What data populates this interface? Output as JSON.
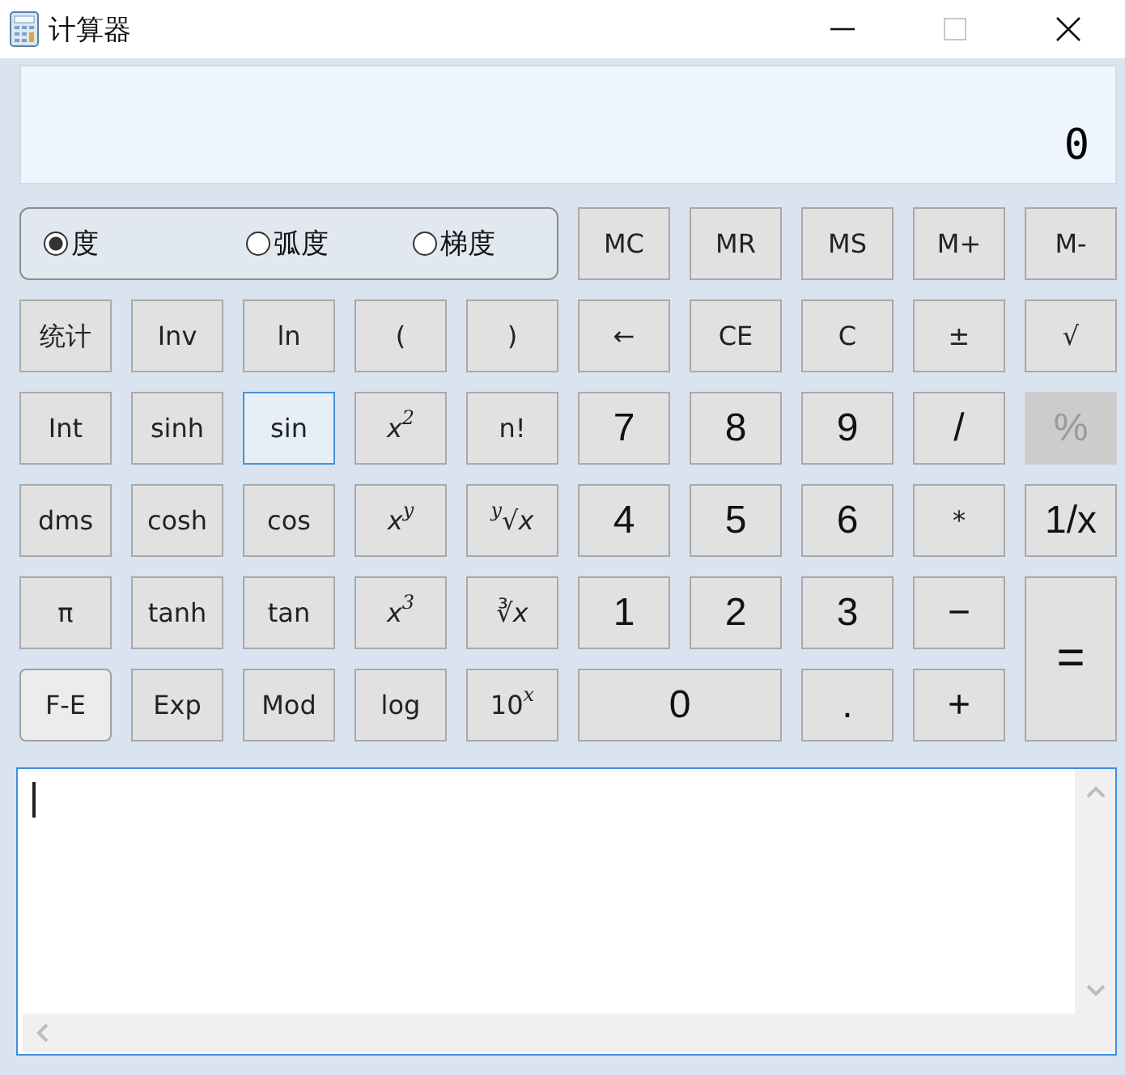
{
  "window": {
    "title": "计算器"
  },
  "display": {
    "value": "0"
  },
  "angle_units": [
    {
      "label": "度",
      "selected": true
    },
    {
      "label": "弧度",
      "selected": false
    },
    {
      "label": "梯度",
      "selected": false
    }
  ],
  "memory_keys": [
    {
      "label": "MC"
    },
    {
      "label": "MR"
    },
    {
      "label": "MS"
    },
    {
      "label": "M+"
    },
    {
      "label": "M-"
    }
  ],
  "keys": [
    {
      "label": "统计",
      "kind": "key",
      "focused": false,
      "disabled": false
    },
    {
      "label": "Inv",
      "kind": "key",
      "focused": false,
      "disabled": false
    },
    {
      "label": "ln",
      "kind": "key",
      "focused": false,
      "disabled": false
    },
    {
      "label": "(",
      "kind": "key",
      "focused": false,
      "disabled": false
    },
    {
      "label": ")",
      "kind": "key",
      "focused": false,
      "disabled": false
    },
    {
      "label": "←",
      "kind": "key",
      "focused": false,
      "disabled": false
    },
    {
      "label": "CE",
      "kind": "key",
      "focused": false,
      "disabled": false
    },
    {
      "label": "C",
      "kind": "key",
      "focused": false,
      "disabled": false
    },
    {
      "label": "±",
      "kind": "key",
      "focused": false,
      "disabled": false
    },
    {
      "label": "√",
      "kind": "key",
      "focused": false,
      "disabled": false
    },
    {
      "label": "Int",
      "kind": "key",
      "focused": false,
      "disabled": false
    },
    {
      "label": "sinh",
      "kind": "key",
      "focused": false,
      "disabled": false
    },
    {
      "label": "sin",
      "kind": "key",
      "focused": true,
      "disabled": false
    },
    {
      "label": "*x*$^{2}$",
      "kind": "key",
      "focused": false,
      "disabled": false
    },
    {
      "label": "n!",
      "kind": "key",
      "focused": false,
      "disabled": false
    },
    {
      "label": "7",
      "kind": "digit",
      "focused": false,
      "disabled": false
    },
    {
      "label": "8",
      "kind": "digit",
      "focused": false,
      "disabled": false
    },
    {
      "label": "9",
      "kind": "digit",
      "focused": false,
      "disabled": false
    },
    {
      "label": "/",
      "kind": "digit",
      "focused": false,
      "disabled": false
    },
    {
      "label": "%",
      "kind": "digit",
      "focused": false,
      "disabled": true
    },
    {
      "label": "dms",
      "kind": "key",
      "focused": false,
      "disabled": false
    },
    {
      "label": "cosh",
      "kind": "key",
      "focused": false,
      "disabled": false
    },
    {
      "label": "cos",
      "kind": "key",
      "focused": false,
      "disabled": false
    },
    {
      "label": "*x*$^{y}$",
      "kind": "key",
      "focused": false,
      "disabled": false
    },
    {
      "label": "$^{y}$√*x*",
      "kind": "key",
      "focused": false,
      "disabled": false
    },
    {
      "label": "4",
      "kind": "digit",
      "focused": false,
      "disabled": false
    },
    {
      "label": "5",
      "kind": "digit",
      "focused": false,
      "disabled": false
    },
    {
      "label": "6",
      "kind": "digit",
      "focused": false,
      "disabled": false
    },
    {
      "label": "*",
      "kind": "key",
      "focused": false,
      "disabled": false
    },
    {
      "label": "1/x",
      "kind": "digit",
      "focused": false,
      "disabled": false
    },
    {
      "label": "π",
      "kind": "key",
      "focused": false,
      "disabled": false
    },
    {
      "label": "tanh",
      "kind": "key",
      "focused": false,
      "disabled": false
    },
    {
      "label": "tan",
      "kind": "key",
      "focused": false,
      "disabled": false
    },
    {
      "label": "*x*$^{3}$",
      "kind": "key",
      "focused": false,
      "disabled": false
    },
    {
      "label": "∛*x*",
      "kind": "key",
      "focused": false,
      "disabled": false
    },
    {
      "label": "1",
      "kind": "digit",
      "focused": false,
      "disabled": false
    },
    {
      "label": "2",
      "kind": "digit",
      "focused": false,
      "disabled": false
    },
    {
      "label": "3",
      "kind": "digit",
      "focused": false,
      "disabled": false
    },
    {
      "label": "−",
      "kind": "digit",
      "focused": false,
      "disabled": false
    },
    {
      "label": "=",
      "kind": "tall",
      "focused": false,
      "disabled": false
    },
    {
      "label": "F-E",
      "kind": "toggle",
      "focused": false,
      "disabled": false
    },
    {
      "label": "Exp",
      "kind": "key",
      "focused": false,
      "disabled": false
    },
    {
      "label": "Mod",
      "kind": "key",
      "focused": false,
      "disabled": false
    },
    {
      "label": "log",
      "kind": "key",
      "focused": false,
      "disabled": false
    },
    {
      "label": "10$^{x}$",
      "kind": "key",
      "focused": false,
      "disabled": false
    },
    {
      "label": "0",
      "kind": "wide",
      "focused": false,
      "disabled": false
    },
    {
      "label": ".",
      "kind": "digit",
      "focused": false,
      "disabled": false
    },
    {
      "label": "+",
      "kind": "digit",
      "focused": false,
      "disabled": false
    }
  ]
}
